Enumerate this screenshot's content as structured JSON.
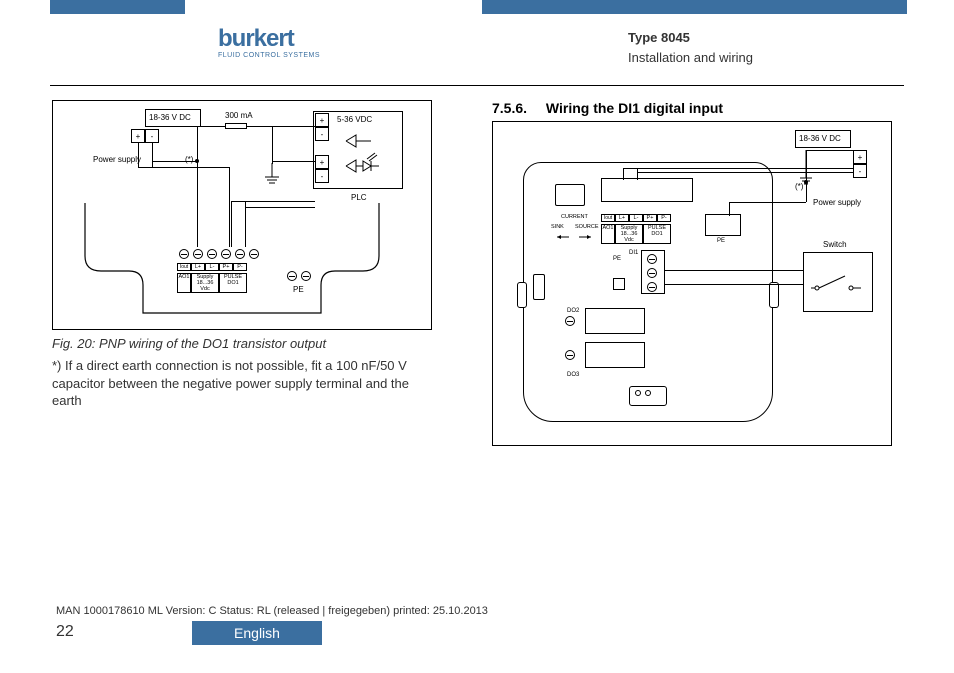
{
  "logo": {
    "name": "burkert",
    "tagline": "FLUID CONTROL SYSTEMS"
  },
  "header": {
    "type": "Type 8045",
    "section": "Installation and wiring"
  },
  "left": {
    "voltage_supply": "18-36 V DC",
    "fuse": "300 mA",
    "plc_voltage": "5-36 VDC",
    "plc_label": "PLC",
    "power_supply": "Power supply",
    "asterisk": "(*)",
    "pe": "PE",
    "plus": "+",
    "minus": "-",
    "terminals": {
      "iout": "Iout",
      "lp": "L+",
      "lm": "L-",
      "pp": "P+",
      "pm": "P-",
      "ao1": "AO1",
      "supply": "Supply\n18...36 Vdc",
      "pulse": "PULSE\nDO1"
    },
    "fig_caption": "Fig. 20:   PNP wiring of the DO1 transistor output",
    "fig_note": "*) If a direct earth connection is not possible, fit a 100 nF/50 V capacitor between the negative power supply terminal and the earth"
  },
  "right": {
    "section_num": "7.5.6.",
    "section_title": "Wiring the DI1 digital input",
    "voltage_supply": "18-36 V DC",
    "power_supply": "Power supply",
    "switch": "Switch",
    "asterisk": "(*)",
    "pe": "PE",
    "plus": "+",
    "minus": "-",
    "di1": "DI1",
    "do2": "DO2",
    "do3": "DO3",
    "current": "CURRENT",
    "sink": "SINK",
    "source": "SOURCE",
    "terminals": {
      "iout": "Iout",
      "lp": "L+",
      "lm": "L-",
      "pp": "P+",
      "pm": "P-",
      "ao1": "AO1",
      "supply": "Supply\n18...36 Vdc",
      "pulse": "PULSE\nDO1"
    }
  },
  "footer": {
    "line": "MAN  1000178610  ML   Version: C Status: RL  (released | freigegeben)   printed: 25.10.2013",
    "page": "22",
    "language": "English"
  }
}
